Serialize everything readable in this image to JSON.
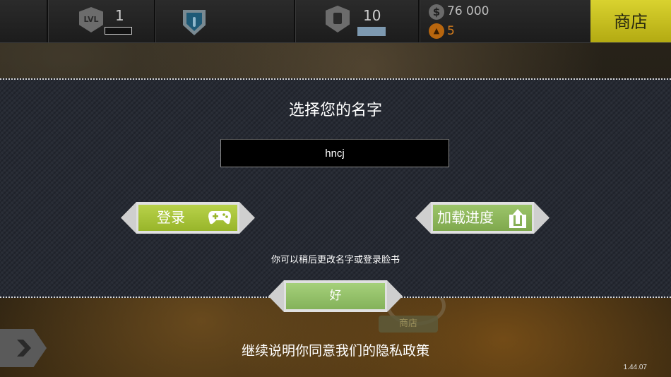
{
  "hud": {
    "level": "1",
    "level_icon": "LVL",
    "fuel": "10",
    "money_symbol": "$",
    "money": "76 000",
    "gold": "5",
    "shop_label": "商店"
  },
  "dialog": {
    "title": "选择您的名字",
    "name_value": "hncj",
    "login_label": "登录",
    "load_label": "加载进度",
    "hint": "你可以稍后更改名字或登录脸书",
    "ok_label": "好"
  },
  "background": {
    "shop_badge": "商店"
  },
  "footer": {
    "privacy": "继续说明你同意我们的隐私政策",
    "version": "1.44.07"
  },
  "icons": [
    "level-icon",
    "shield-icon",
    "fuel-icon",
    "money-icon",
    "gold-icon",
    "gamepad-icon",
    "upload-icon",
    "back-arrow-icon"
  ],
  "colors": {
    "shop_button": "#c9c11f",
    "login_button": "#a7c43a",
    "load_button": "#8cb65c",
    "gold": "#d37c1d",
    "dialog_bg": "#262a33"
  }
}
